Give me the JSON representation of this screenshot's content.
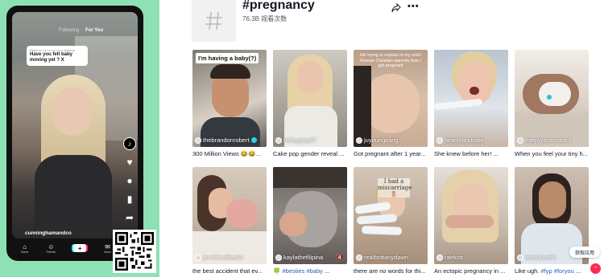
{
  "promo": {
    "tabs": {
      "following": "Following",
      "for_you": "For You"
    },
    "comment": {
      "meta": "Reply to f a l s e e l a u rebecca",
      "text": "Have you felt baby moving yet ? X"
    },
    "username": "cunninghamandco",
    "nav": [
      {
        "icon": "home-icon",
        "glyph": "⌂",
        "label": "Home"
      },
      {
        "icon": "friends-icon",
        "glyph": "☺",
        "label": "Friends"
      },
      {
        "icon": "plus-icon",
        "glyph": "+",
        "label": ""
      },
      {
        "icon": "inbox-icon",
        "glyph": "✉",
        "label": "Inbox"
      },
      {
        "icon": "profile-icon",
        "glyph": "",
        "label": ""
      }
    ]
  },
  "header": {
    "title": "#pregnancy",
    "views": "76.3B 观看次数"
  },
  "videos": [
    {
      "author": "thebrandonrobert",
      "verified": true,
      "caption": "300 Million Views 😂😂😂 ha...",
      "overlay": "I'm having a baby(?)"
    },
    {
      "author": "haleygray67",
      "verified": false,
      "caption": "Cake pop gender reveal ..."
    },
    {
      "author": "juyoungkang",
      "verified": false,
      "caption": "Got pregnant after 1 year...",
      "overlay": "Me trying to explain to my strict Korean Christian parents how I got pregnant"
    },
    {
      "author": "janelleandkate",
      "verified": false,
      "caption": "She knew before her! ..."
    },
    {
      "author": "meggysuemalouf",
      "verified": false,
      "caption": "When you feel your tiny h..."
    },
    {
      "author": "jenniferaffleckk",
      "verified": false,
      "caption": "the best accident that ev..."
    },
    {
      "author": "kaylathefilipina",
      "verified": false,
      "caption_prefix": "🍀 ",
      "caption_ht": "#besties #baby",
      "caption_suffix": " ...",
      "muted": true
    },
    {
      "author": "realbrittanydawn",
      "verified": false,
      "caption": "there are no words for thi...",
      "overlay": "I had a miscarriage 🌷"
    },
    {
      "author": "raefost",
      "verified": false,
      "caption": "An ectopic pregnancy in ..."
    },
    {
      "author": "iamkaleahh",
      "verified": false,
      "caption_prefix": "Like ugh. ",
      "caption_ht": "#fyp #foryou",
      "caption_suffix": " ..."
    }
  ],
  "get_app": "获取应用",
  "colors": {
    "accent": "#fe2c55",
    "promo_bg": "#8ee0b5",
    "hashtag": "#2b5db9",
    "verified": "#20d5ec"
  }
}
